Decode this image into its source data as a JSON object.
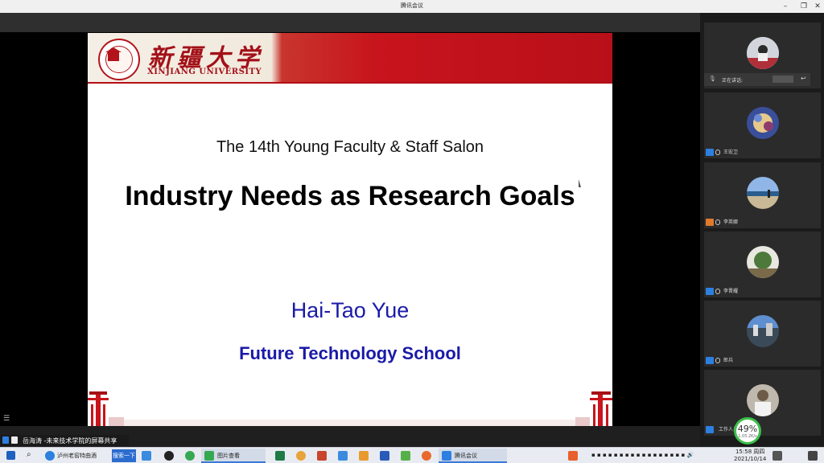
{
  "app": {
    "title": "腾讯会议"
  },
  "slide": {
    "university_cn": "新疆大学",
    "university_en": "XINJIANG UNIVERSITY",
    "seal_text": "XINJIANG UNIVERSITY",
    "salon": "The 14th Young Faculty & Staff Salon",
    "title": "Industry Needs as Research Goals",
    "author": "Hai-Tao Yue",
    "school": "Future Technology School"
  },
  "sidebar": {
    "speaking_label": "正在讲话:",
    "participants": [
      {
        "name": ""
      },
      {
        "name": "王宏卫"
      },
      {
        "name": "李英娜"
      },
      {
        "name": "李晋耀"
      },
      {
        "name": "郎兵"
      },
      {
        "name": "工作人员"
      }
    ]
  },
  "share": {
    "label": "岳海涛 -未来技术学院的屏幕共享"
  },
  "network": {
    "percent": "49%",
    "speed": "1.05.2K/s"
  },
  "taskbar": {
    "apps": [
      {
        "label": "泸州老窖特曲酒"
      },
      {
        "label": "搜索一下"
      },
      {
        "label": "图片查看"
      },
      {
        "label": "腾讯会议"
      }
    ],
    "clock_time": "15:58 周四",
    "clock_date": "2021/10/14"
  },
  "colors": {
    "accent_blue": "#2d7fe0",
    "slide_red": "#c8141c",
    "text_blue": "#1a1aa8"
  }
}
